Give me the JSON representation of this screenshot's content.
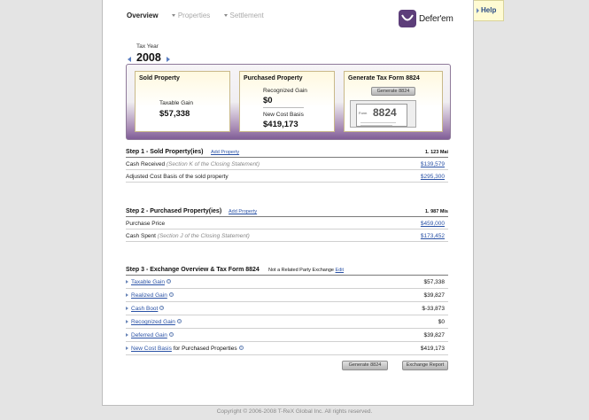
{
  "nav": {
    "overview": "Overview",
    "properties": "Properties",
    "settlement": "Settlement"
  },
  "help": {
    "label": "Help"
  },
  "logo": {
    "text": "Defer'em"
  },
  "tax_year": {
    "label": "Tax Year",
    "value": "2008"
  },
  "cards": {
    "sold": {
      "title": "Sold Property",
      "gain_label": "Taxable Gain",
      "gain_value": "$57,338"
    },
    "purchased": {
      "title": "Purchased Property",
      "recognized_label": "Recognized Gain",
      "recognized_value": "$0",
      "basis_label": "New Cost Basis",
      "basis_value": "$419,173"
    },
    "form": {
      "title": "Generate Tax Form 8824",
      "button": "Generate 8824",
      "form_prefix": "Form",
      "form_number": "8824"
    }
  },
  "step1": {
    "title": "Step 1 - Sold Property(ies)",
    "add_link": "Add Property",
    "right_label": "1. 123 Mai",
    "rows": [
      {
        "label": "Cash Received",
        "note": "(Section K of the Closing Statement)",
        "value": "$139,579"
      },
      {
        "label": "Adjusted Cost Basis of the sold property",
        "note": "",
        "value": "$295,300"
      }
    ]
  },
  "step2": {
    "title": "Step 2 - Purchased Property(ies)",
    "add_link": "Add Property",
    "right_label": "1. 987 Mis",
    "rows": [
      {
        "label": "Purchase Price",
        "note": "",
        "value": "$459,000"
      },
      {
        "label": "Cash Spent",
        "note": "(Section J of the Closing Statement)",
        "value": "$173,452"
      }
    ]
  },
  "step3": {
    "title": "Step 3 - Exchange Overview & Tax Form 8824",
    "related_text": "Not a Related Party Exchange",
    "edit_link": "Edit",
    "rows": [
      {
        "label": "Taxable Gain",
        "suffix": "",
        "value": "$57,338"
      },
      {
        "label": "Realized Gain",
        "suffix": "",
        "value": "$39,827"
      },
      {
        "label": "Cash Boot",
        "suffix": "",
        "value": "$-33,873"
      },
      {
        "label": "Recognized Gain",
        "suffix": "",
        "value": "$0"
      },
      {
        "label": "Deferred Gain",
        "suffix": "",
        "value": "$39,827"
      },
      {
        "label": "New Cost Basis",
        "suffix": "for Purchased Properties",
        "value": "$419,173"
      }
    ],
    "generate_button": "Generate 8824",
    "report_button": "Exchange Report"
  },
  "footer": {
    "text": "Copyright © 2006-2008 T-ReX Global Inc. All rights reserved."
  },
  "colors": {
    "accent": "#5d3e7a",
    "link": "#2a52a6",
    "help_bg": "#fffbd3"
  }
}
